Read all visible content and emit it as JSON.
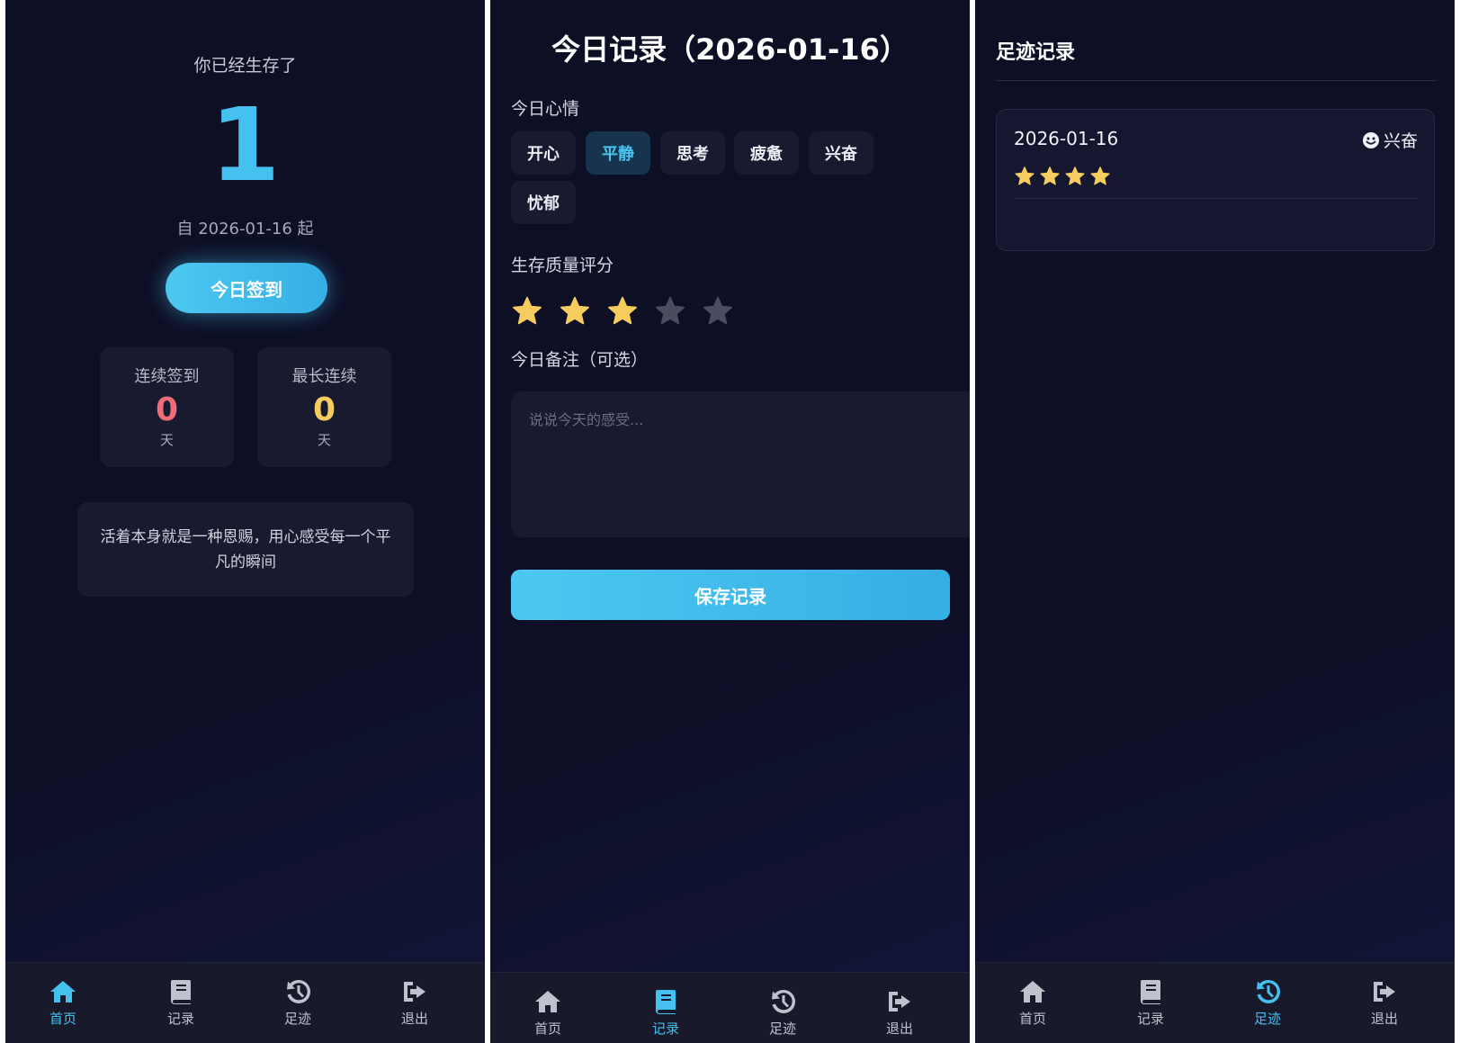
{
  "home": {
    "survived_label": "你已经生存了",
    "survived_days": "1",
    "since_text": "自 2026-01-16 起",
    "checkin_button": "今日签到",
    "stats": [
      {
        "title": "连续签到",
        "value": "0",
        "unit": "天",
        "color": "#ef6b76"
      },
      {
        "title": "最长连续",
        "value": "0",
        "unit": "天",
        "color": "#f7cc5f"
      }
    ],
    "quote": "活着本身就是一种恩赐，用心感受每一个平凡的瞬间"
  },
  "record": {
    "title": "今日记录（2026-01-16）",
    "mood_label": "今日心情",
    "moods": [
      "开心",
      "平静",
      "思考",
      "疲惫",
      "兴奋",
      "忧郁"
    ],
    "selected_mood": "平静",
    "rating_label": "生存质量评分",
    "rating": 3,
    "rating_max": 5,
    "note_label": "今日备注（可选）",
    "note_placeholder": "说说今天的感受...",
    "note_value": "",
    "save_button": "保存记录"
  },
  "history": {
    "title": "足迹记录",
    "entries": [
      {
        "date": "2026-01-16",
        "mood": "兴奋",
        "mood_icon": "smile-icon",
        "stars": 4
      }
    ]
  },
  "nav": {
    "items": [
      {
        "label": "首页",
        "icon": "home-icon"
      },
      {
        "label": "记录",
        "icon": "book-icon"
      },
      {
        "label": "足迹",
        "icon": "history-icon"
      },
      {
        "label": "退出",
        "icon": "logout-icon"
      }
    ],
    "active": {
      "home": "首页",
      "record": "记录",
      "history": "足迹"
    }
  },
  "colors": {
    "accent": "#45c1ef",
    "star_on": "#f7cc5f",
    "star_off": "#4b4c60",
    "background": "#0d0f24"
  }
}
